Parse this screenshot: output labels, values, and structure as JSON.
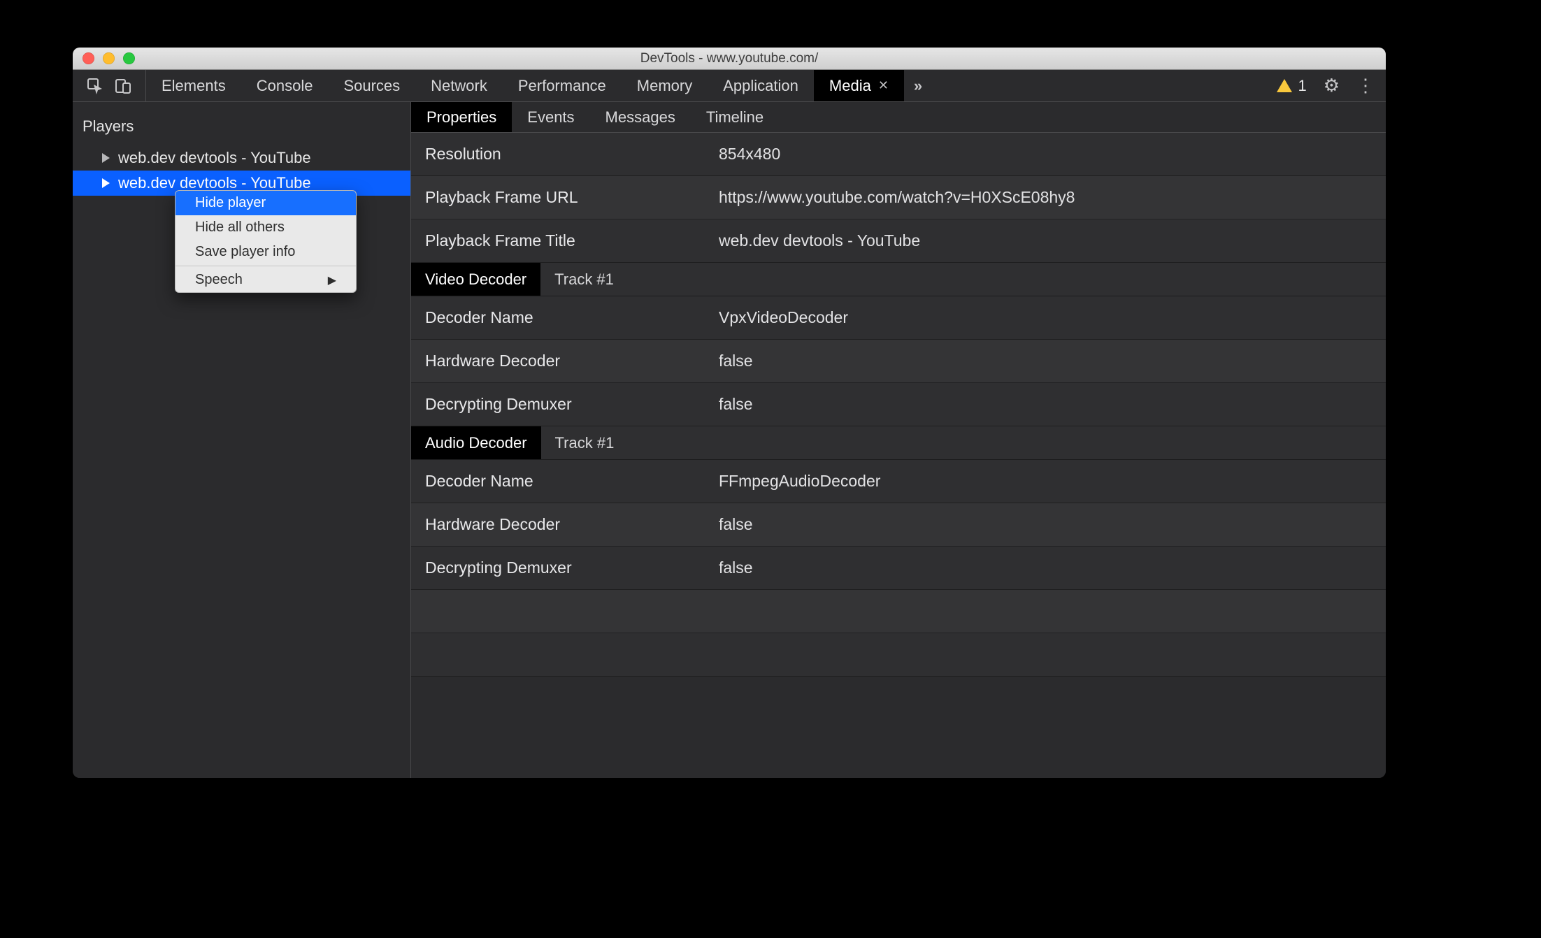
{
  "window": {
    "title": "DevTools - www.youtube.com/"
  },
  "toolbar": {
    "tabs": [
      "Elements",
      "Console",
      "Sources",
      "Network",
      "Performance",
      "Memory",
      "Application",
      "Media"
    ],
    "active_tab": "Media",
    "more_indicator": "»",
    "warning_count": "1"
  },
  "sidebar": {
    "header": "Players",
    "players": [
      {
        "label": "web.dev devtools - YouTube",
        "selected": false
      },
      {
        "label": "web.dev devtools - YouTube",
        "selected": true
      }
    ]
  },
  "context_menu": {
    "items": [
      {
        "label": "Hide player",
        "highlighted": true
      },
      {
        "label": "Hide all others"
      },
      {
        "label": "Save player info"
      }
    ],
    "submenu": {
      "label": "Speech"
    }
  },
  "detail_tabs": {
    "tabs": [
      "Properties",
      "Events",
      "Messages",
      "Timeline"
    ],
    "active": "Properties"
  },
  "properties": {
    "rows": [
      {
        "k": "Resolution",
        "v": "854x480"
      },
      {
        "k": "Playback Frame URL",
        "v": "https://www.youtube.com/watch?v=H0XScE08hy8"
      },
      {
        "k": "Playback Frame Title",
        "v": "web.dev devtools - YouTube"
      }
    ],
    "video_decoder": {
      "title": "Video Decoder",
      "track": "Track #1",
      "rows": [
        {
          "k": "Decoder Name",
          "v": "VpxVideoDecoder"
        },
        {
          "k": "Hardware Decoder",
          "v": "false"
        },
        {
          "k": "Decrypting Demuxer",
          "v": "false"
        }
      ]
    },
    "audio_decoder": {
      "title": "Audio Decoder",
      "track": "Track #1",
      "rows": [
        {
          "k": "Decoder Name",
          "v": "FFmpegAudioDecoder"
        },
        {
          "k": "Hardware Decoder",
          "v": "false"
        },
        {
          "k": "Decrypting Demuxer",
          "v": "false"
        }
      ]
    }
  }
}
